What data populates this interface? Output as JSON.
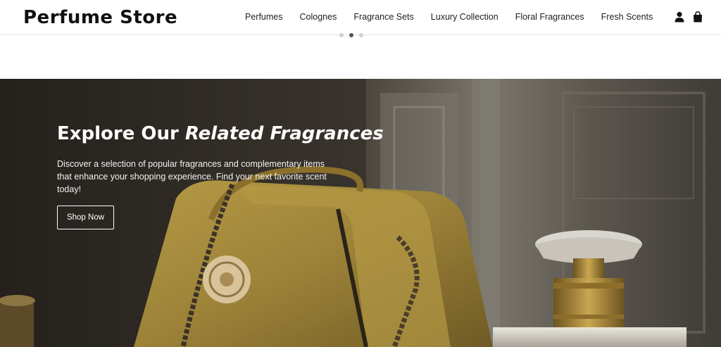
{
  "header": {
    "logo": "Perfume Store",
    "nav": [
      {
        "label": "Perfumes"
      },
      {
        "label": "Colognes"
      },
      {
        "label": "Fragrance Sets"
      },
      {
        "label": "Luxury Collection"
      },
      {
        "label": "Floral Fragrances"
      },
      {
        "label": "Fresh Scents"
      }
    ],
    "icons": [
      "user-icon",
      "shopping-bag-icon"
    ]
  },
  "carousel": {
    "dots": 3,
    "active": 1
  },
  "hero": {
    "title_plain": "Explore Our ",
    "title_emphasis": "Related Fragrances",
    "description": "Discover a selection of popular fragrances and complementary items that enhance your shopping experience. Find your next favorite scent today!",
    "button_label": "Shop Now",
    "image": "handbag-and-perfume-bottle-image"
  }
}
